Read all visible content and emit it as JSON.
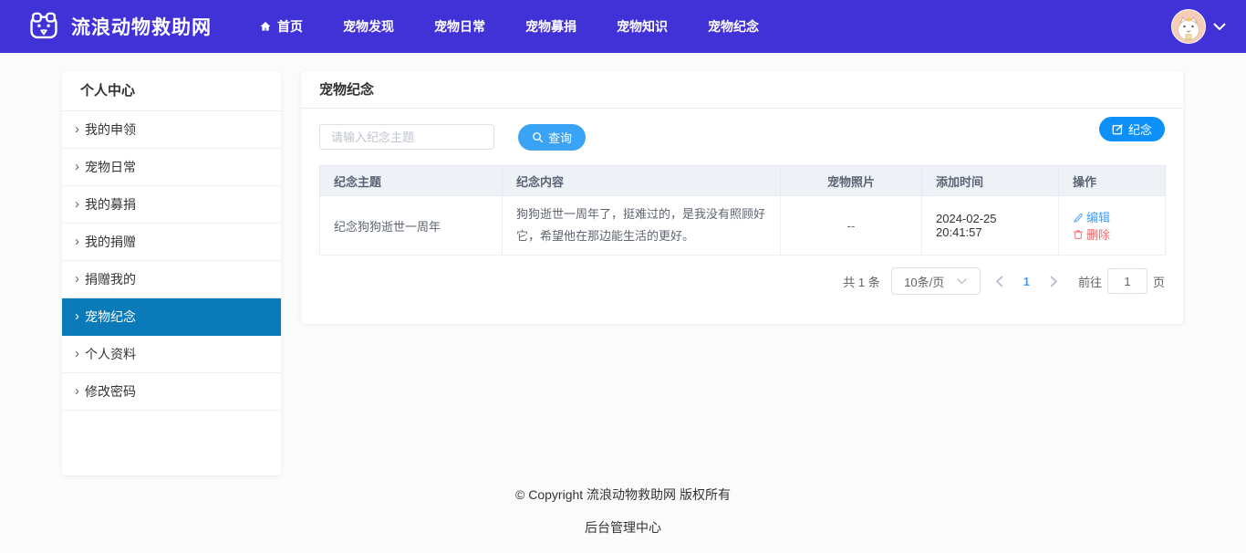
{
  "header": {
    "brand": "流浪动物救助网",
    "nav": [
      {
        "label": "首页"
      },
      {
        "label": "宠物发现"
      },
      {
        "label": "宠物日常"
      },
      {
        "label": "宠物募捐"
      },
      {
        "label": "宠物知识"
      },
      {
        "label": "宠物纪念"
      }
    ]
  },
  "sidebar": {
    "title": "个人中心",
    "items": [
      {
        "label": "我的申领",
        "active": false
      },
      {
        "label": "宠物日常",
        "active": false
      },
      {
        "label": "我的募捐",
        "active": false
      },
      {
        "label": "我的捐赠",
        "active": false
      },
      {
        "label": "捐赠我的",
        "active": false
      },
      {
        "label": "宠物纪念",
        "active": true
      },
      {
        "label": "个人资料",
        "active": false
      },
      {
        "label": "修改密码",
        "active": false
      }
    ]
  },
  "main": {
    "title": "宠物纪念",
    "search": {
      "placeholder": "请输入纪念主题",
      "query_label": "查询"
    },
    "add_button_label": "纪念",
    "table": {
      "headers": [
        "纪念主题",
        "纪念内容",
        "宠物照片",
        "添加时间",
        "操作"
      ],
      "rows": [
        {
          "subject": "纪念狗狗逝世一周年",
          "content": "狗狗逝世一周年了，挺难过的，是我没有照顾好它，希望他在那边能生活的更好。",
          "photo": "--",
          "time": "2024-02-25 20:41:57",
          "edit_label": "编辑",
          "delete_label": "删除"
        }
      ]
    },
    "pagination": {
      "total_text": "共 1 条",
      "page_size": "10条/页",
      "current_page": "1",
      "goto_prefix": "前往",
      "goto_value": "1",
      "goto_suffix": "页"
    }
  },
  "footer": {
    "copyright": "© Copyright 流浪动物救助网 版权所有",
    "admin_link": "后台管理中心"
  },
  "icons": {
    "logo": "dog-face",
    "home": "house",
    "avatar": "cat",
    "chevron_down": "˅",
    "search": "magnifier",
    "add_memorial": "edit-square",
    "edit": "pencil",
    "delete": "trash",
    "prev": "‹",
    "next": "›",
    "sidebar_caret": "›"
  },
  "colors": {
    "topbar_bg": "#4132d8",
    "sidebar_active_bg": "#0a7ab8",
    "query_button": "#3aa3f5",
    "add_button": "#0e90f9",
    "link_blue": "#409eff",
    "delete_red": "#f56c6c",
    "table_header_bg": "#eef1f6"
  }
}
